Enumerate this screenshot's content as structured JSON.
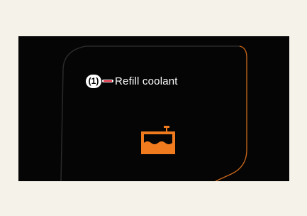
{
  "display": {
    "callout_number": "(1)",
    "warning_message": "Refill coolant"
  },
  "icons": {
    "warning_icon": "coolant-reservoir-icon"
  },
  "colors": {
    "background": "#050505",
    "page": "#f5f2ea",
    "accent": "#f07a1e",
    "text": "#ffffff",
    "leader_line": "#e0223a"
  }
}
